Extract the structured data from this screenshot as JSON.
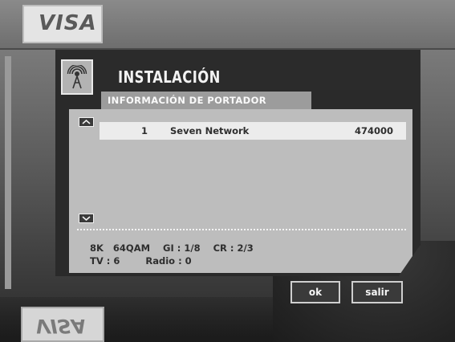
{
  "background": {
    "visa_top": "VISA",
    "visa_bottom": "VISA"
  },
  "dialog": {
    "title": "INSTALACIÓN",
    "icon": "satellite-antenna-icon",
    "subtitle": "INFORMACIÓN DE PORTADOR"
  },
  "carriers": [
    {
      "number": "1",
      "name": "Seven Network",
      "frequency": "474000"
    }
  ],
  "details": {
    "line1": "8K   64QAM    GI : 1/8    CR : 2/3",
    "line2": "TV : 6        Radio : 0"
  },
  "buttons": {
    "ok": "ok",
    "exit": "salir"
  },
  "colors": {
    "frame": "#2a2a2a",
    "panel": "#bdbdbd",
    "selected_row": "#ececec",
    "tab": "#9c9c9c"
  }
}
